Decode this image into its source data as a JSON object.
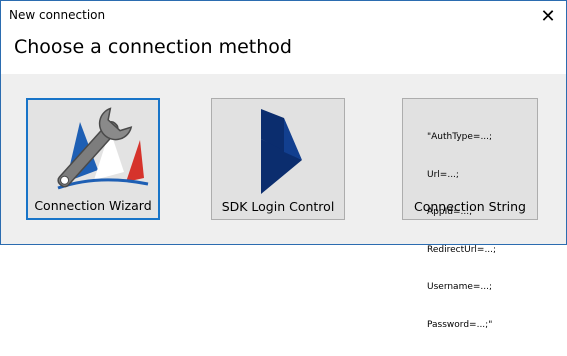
{
  "window": {
    "title": "New connection",
    "close_glyph": "✕"
  },
  "header": {
    "heading": "Choose a connection method"
  },
  "options": [
    {
      "label": "Connection Wizard",
      "icon": "wrench-flag-icon",
      "selected": true
    },
    {
      "label": "SDK Login Control",
      "icon": "dynamics-logo-icon",
      "selected": false
    },
    {
      "label": "Connection String",
      "icon": "connection-string-text",
      "selected": false,
      "lines": [
        "\"AuthType=...;",
        "Url=...;",
        "AppId=...;",
        "RedirectUrl=...;",
        "Username=...;",
        "Password=...;\""
      ]
    }
  ],
  "colors": {
    "accent_border": "#1874c8",
    "button_bg": "#e1e1e1",
    "panel_bg": "#efefef",
    "dynamics_blue": "#0b2d6e",
    "flag_blue": "#1e5fb4",
    "flag_red": "#d6332c"
  }
}
